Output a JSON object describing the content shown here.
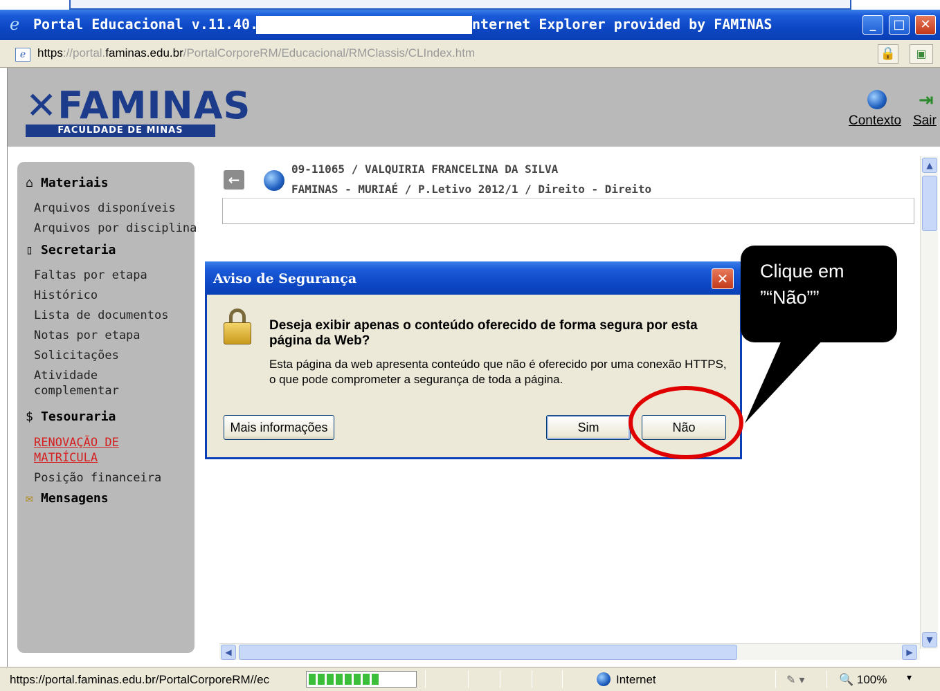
{
  "window": {
    "title": "Portal Educacional v.11.40.0 (",
    "title_right": "nternet Explorer provided by FAMINAS",
    "controls": [
      "_",
      "□",
      "✕"
    ]
  },
  "address": {
    "scheme": "https",
    "url_dim1": "://portal.",
    "domain": "faminas.edu.br",
    "path": "/PortalCorporeRM/Educacional/RMClassis/CLIndex.htm"
  },
  "header": {
    "logo_name": "✕FAMINAS",
    "logo_sub": "FACULDADE DE MINAS",
    "contexto": "Contexto",
    "sair": "Sair"
  },
  "sidebar": {
    "materiais": {
      "label": "Materiais",
      "items": [
        "Arquivos disponíveis",
        "Arquivos por disciplina"
      ]
    },
    "secretaria": {
      "label": "Secretaria",
      "items": [
        "Faltas por etapa",
        "Histórico",
        "Lista de documentos",
        "Notas por etapa",
        "Solicitações",
        "Atividade",
        "complementar"
      ]
    },
    "tesouraria": {
      "label": "Tesouraria",
      "items": [
        "RENOVAÇÃO DE",
        "MATRÍCULA",
        "Posição financeira"
      ]
    },
    "mensagens": {
      "label": "Mensagens"
    }
  },
  "info": {
    "line1": "09-11065 / VALQUIRIA FRANCELINA DA SILVA",
    "line2": "FAMINAS - MURIAÉ / P.Letivo 2012/1  / Direito - Direito"
  },
  "dialog": {
    "title": "Aviso de Segurança",
    "question": "Deseja exibir apenas o conteúdo oferecido de forma segura por esta página da Web?",
    "body": "Esta página da web apresenta conteúdo que não é oferecido por uma conexão HTTPS, o que pode comprometer a segurança de toda a página.",
    "btn_more": "Mais informações",
    "btn_yes": "Sim",
    "btn_no": "Não"
  },
  "callout": {
    "line1": "Clique em",
    "line2": "”“Não””"
  },
  "status": {
    "url": "https://portal.faminas.edu.br/PortalCorporeRM//ec",
    "zone": "Internet",
    "zoom": "100%",
    "progress": 0.65
  },
  "colors": {
    "accent": "#0a3fb5",
    "brand": "#1c3b8a",
    "annotation": "#e00000"
  }
}
